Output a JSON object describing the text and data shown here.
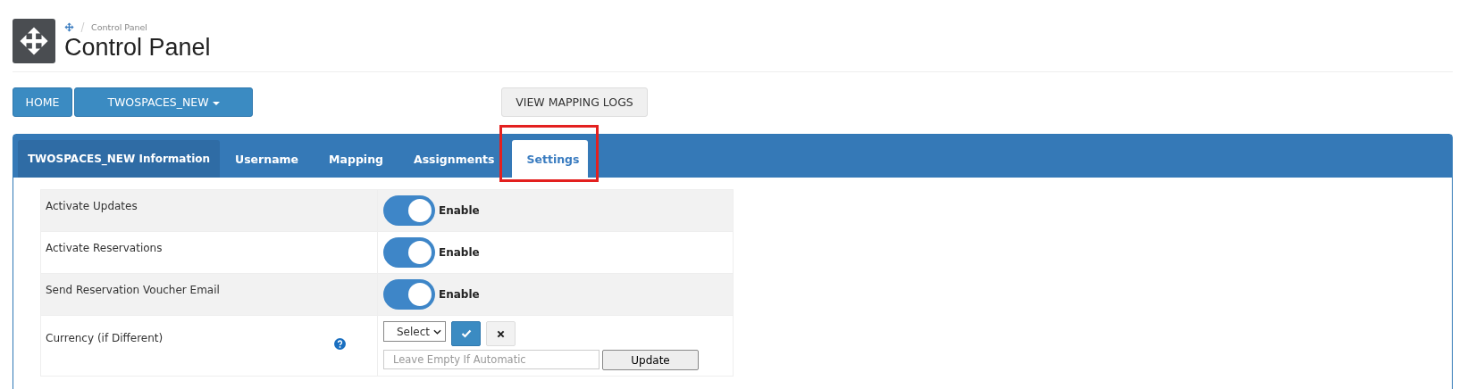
{
  "breadcrumb": [
    "Control Panel"
  ],
  "page_title": "Control Panel",
  "toolbar": {
    "home": "HOME",
    "dropdown": "TWOSPACES_NEW",
    "logs": "VIEW MAPPING LOGS"
  },
  "tabs": [
    {
      "label": "TWOSPACES_NEW Information",
      "selected": false,
      "highlighted": false
    },
    {
      "label": "Username",
      "selected": false,
      "highlighted": false
    },
    {
      "label": "Mapping",
      "selected": false,
      "highlighted": false
    },
    {
      "label": "Assignments",
      "selected": false,
      "highlighted": false
    },
    {
      "label": "Settings",
      "selected": true,
      "highlighted": true
    }
  ],
  "settings": [
    {
      "kind": "toggle",
      "label": "Activate Updates",
      "on": true,
      "state_label": "Enable"
    },
    {
      "kind": "toggle",
      "label": "Activate Reservations",
      "on": true,
      "state_label": "Enable"
    },
    {
      "kind": "toggle",
      "label": "Send Reservation Voucher Email",
      "on": true,
      "state_label": "Enable"
    },
    {
      "kind": "currency",
      "label": "Currency (if Different)",
      "select": "Select",
      "placeholder": "Leave Empty If Automatic",
      "button": "Update"
    }
  ]
}
